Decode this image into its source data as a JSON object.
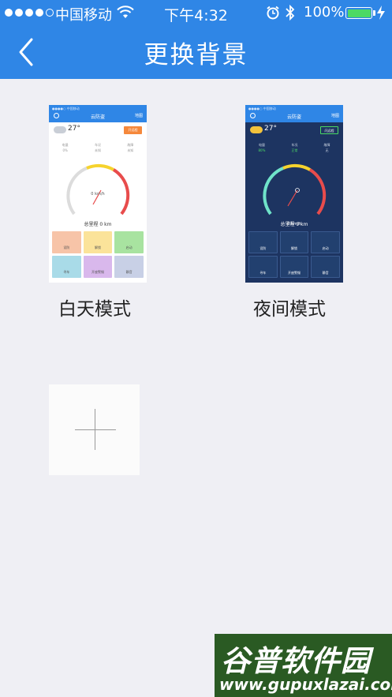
{
  "status_bar": {
    "carrier": "中国移动",
    "time": "下午4:32",
    "battery_percent": "100%"
  },
  "nav": {
    "title": "更换背景"
  },
  "themes": [
    {
      "label": "白天模式",
      "preview": {
        "app_title": "云防盗",
        "map": "地图",
        "temp": "27°",
        "button": "开远程",
        "info": [
          "电量",
          "车况",
          "故障"
        ],
        "info_values": [
          "0%",
          "未知",
          "未知"
        ],
        "speed": "0 km/h",
        "odometer": "总里程 0 km",
        "buttons": [
          "设防",
          "解锁",
          "启动",
          "寻车",
          "开座警惕",
          "静音"
        ],
        "button_colors": [
          "#f7c4a8",
          "#fbe39a",
          "#a8e3a0",
          "#a9dbe8",
          "#d9b8ec",
          "#c8d0e6"
        ]
      }
    },
    {
      "label": "夜间模式",
      "preview": {
        "app_title": "云防盗",
        "map": "地图",
        "temp": "27°",
        "button": "闪远程",
        "info": [
          "电量",
          "车况",
          "故障"
        ],
        "info_values": [
          "80%",
          "正常",
          "无"
        ],
        "speed": "0 km/h",
        "odometer": "总里程 0 km",
        "buttons": [
          "设防",
          "解锁",
          "启动",
          "寻车",
          "开座警惕",
          "静音"
        ]
      }
    }
  ],
  "colors": {
    "header": "#2f86e6",
    "background": "#efeff4",
    "night_bg": "#1d3461"
  },
  "watermark": {
    "logo": "谷普软件园",
    "url": "www.gupuxlazai.com"
  }
}
